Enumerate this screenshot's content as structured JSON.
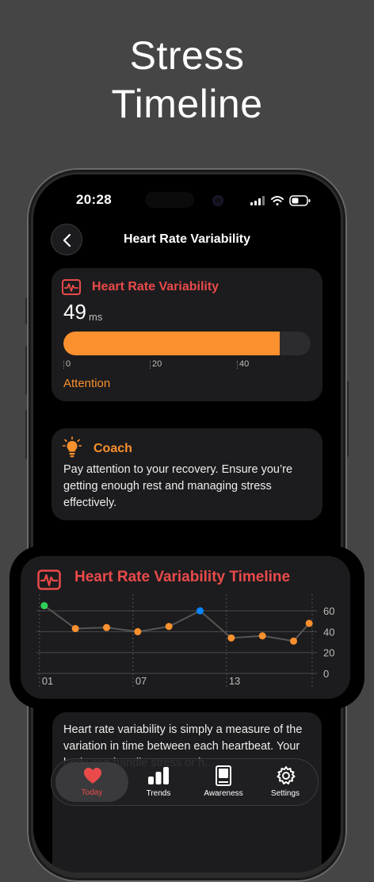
{
  "headline": {
    "line1": "Stress",
    "line2": "Timeline"
  },
  "status_bar": {
    "time": "20:28"
  },
  "nav": {
    "title": "Heart Rate Variability",
    "back_icon": "chevron-left-icon"
  },
  "hrv_card": {
    "title": "Heart Rate Variability",
    "icon": "heart-monitor-icon",
    "value": "49",
    "unit": "ms",
    "progress_value": 49,
    "scale_max": 56,
    "scale_ticks": [
      "0",
      "20",
      "40"
    ],
    "status": "Attention"
  },
  "coach_card": {
    "title": "Coach",
    "icon": "lightbulb-icon",
    "text": "Pay attention to your recovery. Ensure you’re getting enough rest and managing stress effectively."
  },
  "timeline_card": {
    "title": "Heart Rate Variability Timeline",
    "icon": "heart-monitor-icon"
  },
  "chart_data": {
    "type": "line",
    "title": "Heart Rate Variability Timeline",
    "x": [
      1,
      3,
      5,
      7,
      9,
      11,
      13,
      15,
      17,
      18
    ],
    "x_tick_labels": [
      "01",
      "07",
      "13"
    ],
    "x_ticks": [
      1,
      7,
      13
    ],
    "values": [
      65,
      43,
      44,
      40,
      45,
      60,
      34,
      36,
      31,
      48
    ],
    "highlight": [
      {
        "index": 0,
        "color": "#30d158"
      },
      {
        "index": 5,
        "color": "#0a84ff"
      }
    ],
    "ylim": [
      0,
      70
    ],
    "y_ticks": [
      0,
      20,
      40,
      60
    ],
    "grid": true,
    "line_color": "#555555",
    "point_color": "#fb902e"
  },
  "info_card": {
    "text": "Heart rate variability is simply a measure of the variation in time between each heartbeat. Your body can handle stress or h..."
  },
  "tabbar": {
    "tabs": [
      {
        "label": "Today",
        "icon": "heart-icon",
        "active": true
      },
      {
        "label": "Trends",
        "icon": "bar-chart-icon"
      },
      {
        "label": "Awareness",
        "icon": "book-icon"
      },
      {
        "label": "Settings",
        "icon": "gear-icon"
      }
    ]
  },
  "colors": {
    "accent_red": "#ea4a4a",
    "accent_orange": "#fb902e",
    "card_bg": "#1c1c1e",
    "page_bg": "#454545"
  }
}
